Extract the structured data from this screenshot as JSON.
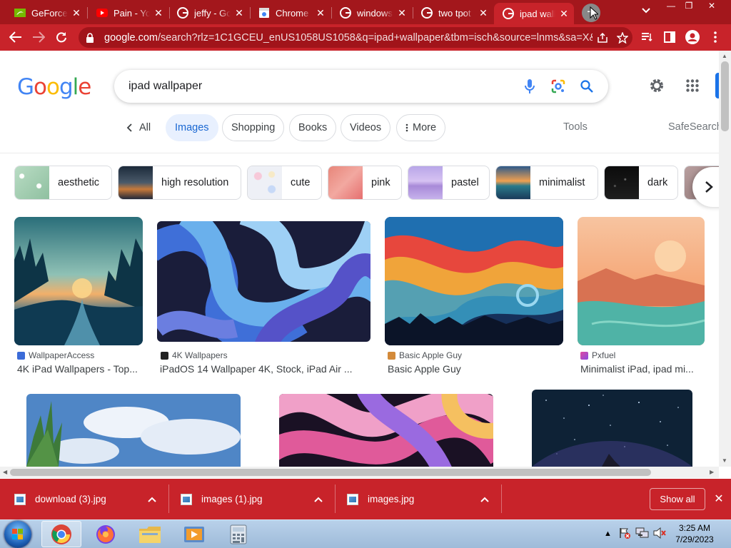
{
  "browser": {
    "tabs": [
      {
        "title": "GeForce",
        "icon": "nvidia-icon"
      },
      {
        "title": "Pain - You",
        "icon": "youtube-icon"
      },
      {
        "title": "jeffy - Go",
        "icon": "google-icon"
      },
      {
        "title": "Chrome",
        "icon": "chrome-web-store-icon"
      },
      {
        "title": "windows",
        "icon": "google-icon"
      },
      {
        "title": "two tpot",
        "icon": "google-icon"
      },
      {
        "title": "ipad wall",
        "icon": "google-icon",
        "active": true
      }
    ],
    "url_host": "google.com",
    "url_rest": "/search?rlz=1C1GCEU_enUS1058US1058&q=ipad+wallpaper&tbm=isch&source=lnms&sa=X&...",
    "accent_color": "#c8232a",
    "tabstrip_color": "#a3171c"
  },
  "google": {
    "logo_text": "Google",
    "query": "ipad wallpaper",
    "nav": {
      "back_label": "All",
      "images_label": "Images",
      "shopping_label": "Shopping",
      "books_label": "Books",
      "videos_label": "Videos",
      "more_label": "More",
      "tools_label": "Tools",
      "safesearch_label": "SafeSearch"
    },
    "refinements": [
      "aesthetic",
      "high resolution",
      "cute",
      "pink",
      "pastel",
      "minimalist",
      "dark"
    ],
    "results": [
      {
        "source": "WallpaperAccess",
        "title": "4K iPad Wallpapers - Top..."
      },
      {
        "source": "4K Wallpapers",
        "title": "iPadOS 14 Wallpaper 4K, Stock, iPad Air ..."
      },
      {
        "source": "Basic Apple Guy",
        "title": "Basic Apple Guy"
      },
      {
        "source": "Pxfuel",
        "title": "Minimalist iPad, ipad mi..."
      }
    ]
  },
  "downloads": {
    "items": [
      "download (3).jpg",
      "images (1).jpg",
      "images.jpg"
    ],
    "show_all_label": "Show all"
  },
  "taskbar": {
    "apps": [
      "chrome-icon",
      "firefox-icon",
      "file-explorer-icon",
      "media-player-icon",
      "calculator-icon"
    ],
    "time": "3:25 AM",
    "date": "7/29/2023"
  }
}
